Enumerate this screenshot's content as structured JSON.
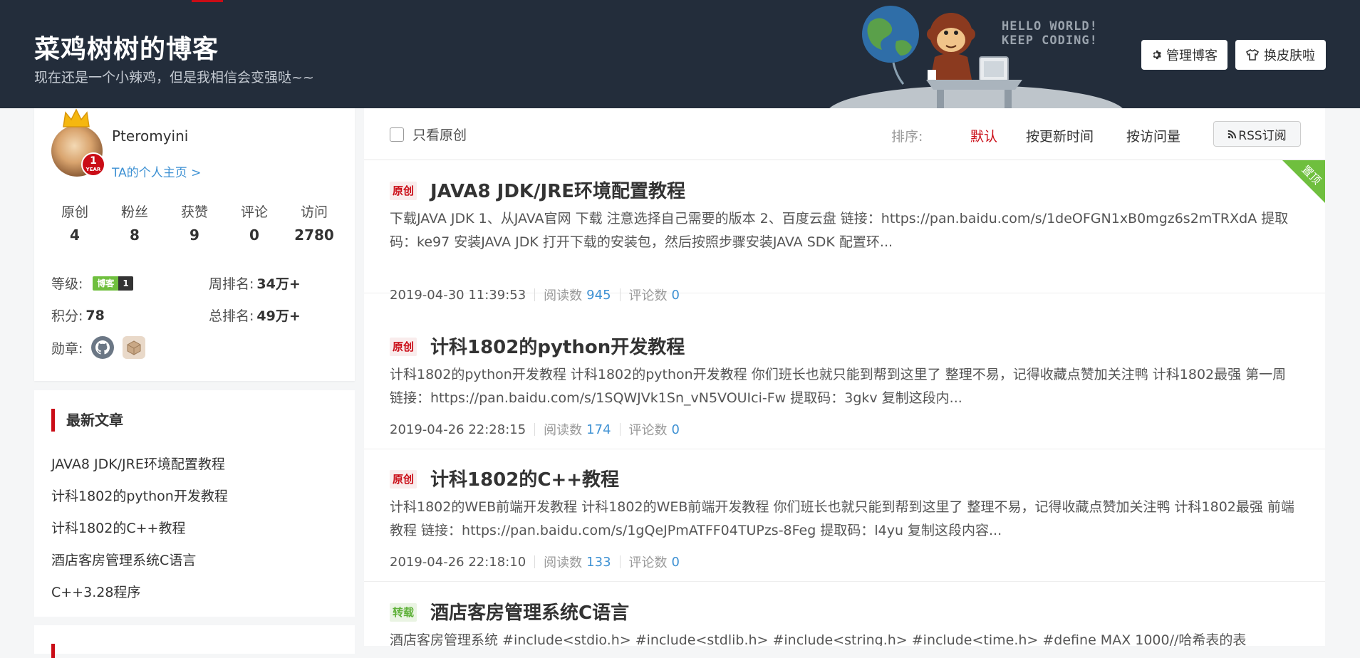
{
  "header": {
    "title": "菜鸡树树的博客",
    "subtitle": "现在还是一个小辣鸡，但是我相信会变强哒~~",
    "hello_line1": "HELLO WORLD!",
    "hello_line2": "KEEP CODING!",
    "manage_btn": "管理博客",
    "skin_btn": "换皮肤啦",
    "bg_color": "#232d3b"
  },
  "profile": {
    "username": "Pteromyini",
    "homepage_link": "TA的个人主页 >",
    "year_badge_num": "1",
    "year_badge_text": "YEAR",
    "stats": [
      {
        "label": "原创",
        "value": "4"
      },
      {
        "label": "粉丝",
        "value": "8"
      },
      {
        "label": "获赞",
        "value": "9"
      },
      {
        "label": "评论",
        "value": "0"
      },
      {
        "label": "访问",
        "value": "2780"
      }
    ],
    "level_label": "等级:",
    "level_badge_text": "博客",
    "level_badge_num": "1",
    "weekly_rank_label": "周排名:",
    "weekly_rank_value": "34万+",
    "points_label": "积分:",
    "points_value": "78",
    "total_rank_label": "总排名:",
    "total_rank_value": "49万+",
    "medals_label": "勋章:"
  },
  "recent": {
    "title": "最新文章",
    "items": [
      "JAVA8 JDK/JRE环境配置教程",
      "计科1802的python开发教程",
      "计科1802的C++教程",
      "酒店客房管理系统C语言",
      "C++3.28程序"
    ]
  },
  "filter": {
    "only_original": "只看原创",
    "sort_label": "排序:",
    "sort_default": "默认",
    "sort_update": "按更新时间",
    "sort_visit": "按访问量",
    "rss": "RSS订阅"
  },
  "pin_label": "置顶",
  "articles": [
    {
      "tag": "原创",
      "title": "JAVA8 JDK/JRE环境配置教程",
      "summary": "下载JAVA JDK 1、从JAVA官网 下载 注意选择自己需要的版本 2、百度云盘 链接：https://pan.baidu.com/s/1deOFGN1xB0mgz6s2mTRXdA 提取码：ke97 安装JAVA JDK 打开下载的安装包，然后按照步骤安装JAVA SDK 配置环...",
      "date": "2019-04-30 11:39:53",
      "read_label": "阅读数",
      "read": "945",
      "comment_label": "评论数",
      "comment": "0"
    },
    {
      "tag": "原创",
      "title": "计科1802的python开发教程",
      "summary": "计科1802的python开发教程 计科1802的python开发教程 你们班长也就只能到帮到这里了 整理不易，记得收藏点赞加关注鸭 计科1802最强 第一周 链接：https://pan.baidu.com/s/1SQWJVk1Sn_vN5VOUIci-Fw 提取码：3gkv 复制这段内...",
      "date": "2019-04-26 22:28:15",
      "read_label": "阅读数",
      "read": "174",
      "comment_label": "评论数",
      "comment": "0"
    },
    {
      "tag": "原创",
      "title": "计科1802的C++教程",
      "summary": "计科1802的WEB前端开发教程 计科1802的WEB前端开发教程 你们班长也就只能到帮到这里了 整理不易，记得收藏点赞加关注鸭 计科1802最强 前端教程 链接：https://pan.baidu.com/s/1gQeJPmATFF04TUPzs-8Feg 提取码：l4yu 复制这段内容...",
      "date": "2019-04-26 22:18:10",
      "read_label": "阅读数",
      "read": "133",
      "comment_label": "评论数",
      "comment": "0"
    },
    {
      "tag": "转载",
      "title": "酒店客房管理系统C语言",
      "summary": "酒店客房管理系统 #include<stdio.h> #include<stdlib.h> #include<string.h> #include<time.h> #define MAX 1000//哈希表的表"
    }
  ]
}
